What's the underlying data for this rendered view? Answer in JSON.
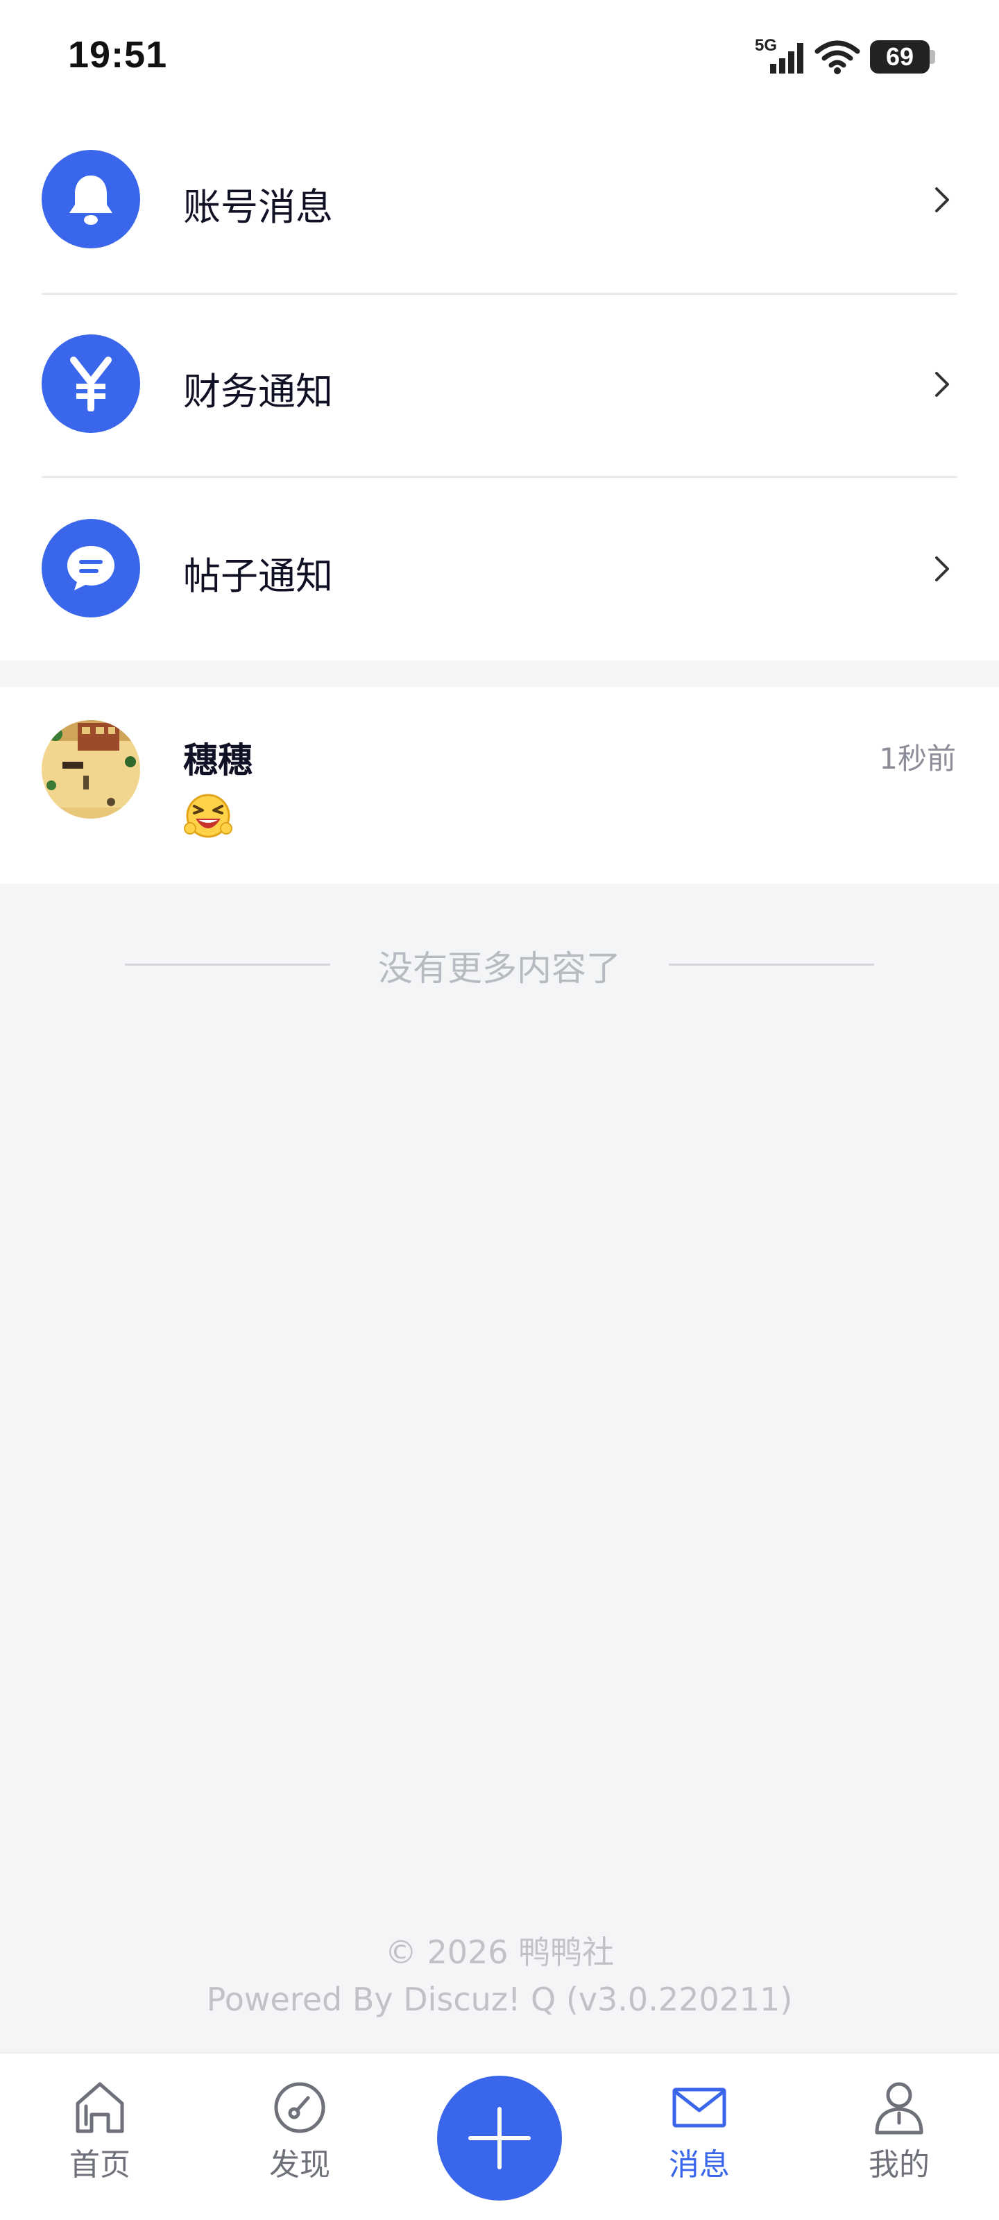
{
  "status": {
    "time": "19:51",
    "network": "5G",
    "battery": "69"
  },
  "notices": [
    {
      "label": "账号消息",
      "icon": "bell-icon"
    },
    {
      "label": "财务通知",
      "icon": "yen-icon"
    },
    {
      "label": "帖子通知",
      "icon": "chat-icon"
    }
  ],
  "dialog": {
    "name": "穗穗",
    "time": "1秒前",
    "preview_icon": "laughing-emoji-icon"
  },
  "no_more": "没有更多内容了",
  "footer": {
    "copyright": "© 2026 鸭鸭社",
    "powered": "Powered By Discuz! Q (v3.0.220211)"
  },
  "tabs": [
    {
      "label": "首页",
      "icon": "home-icon"
    },
    {
      "label": "发现",
      "icon": "compass-icon"
    },
    {
      "label": "消息",
      "icon": "mail-icon",
      "active": true
    },
    {
      "label": "我的",
      "icon": "user-icon"
    }
  ],
  "colors": {
    "accent": "#3a66eb",
    "background": "#f4f5f7",
    "text": "#111126",
    "muted": "#8a8c98"
  }
}
